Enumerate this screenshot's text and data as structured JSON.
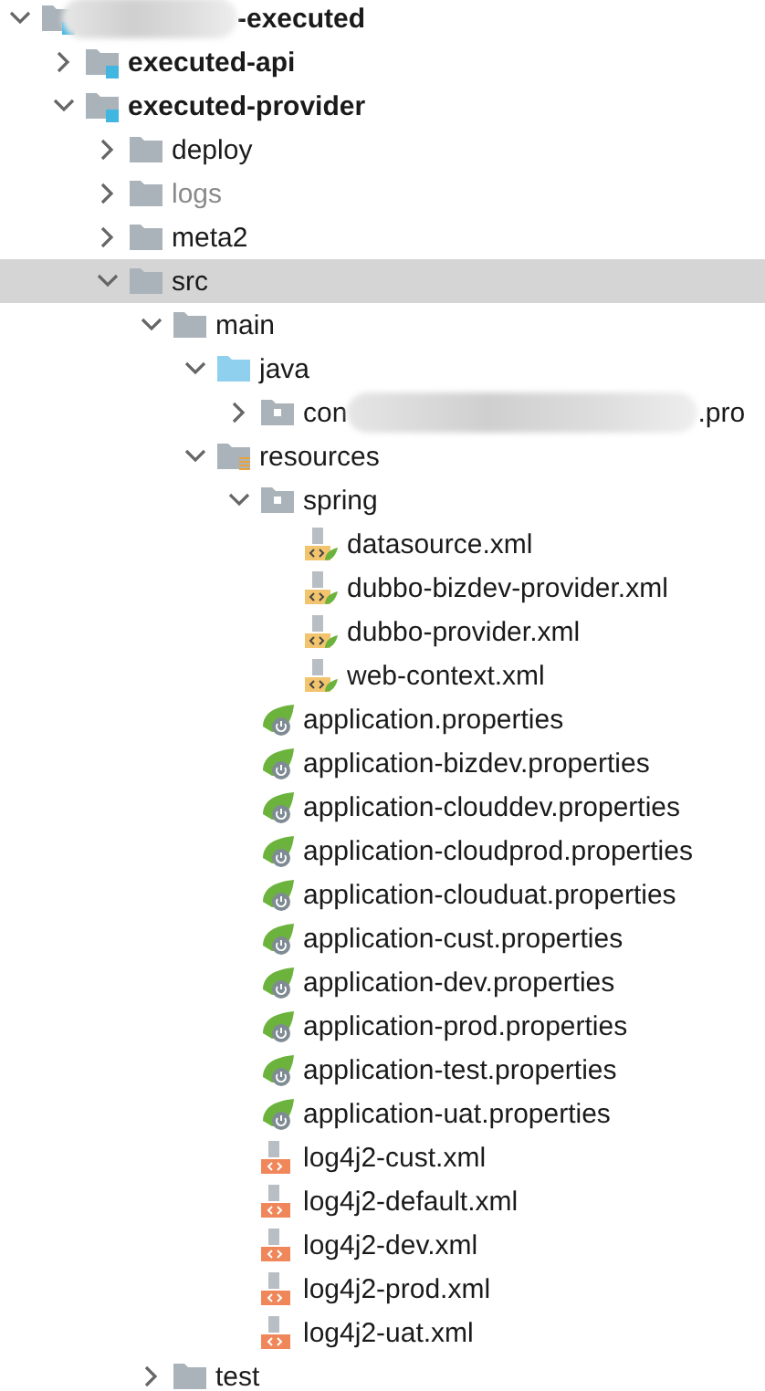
{
  "tree": [
    {
      "label": "-executed",
      "kind": "module",
      "redacted": true,
      "expanded": true,
      "selected": false,
      "children": [
        {
          "label": "executed-api",
          "kind": "module",
          "expanded": false,
          "selected": false
        },
        {
          "label": "executed-provider",
          "kind": "module",
          "expanded": true,
          "selected": false,
          "children": [
            {
              "label": "deploy",
              "kind": "folder",
              "expanded": false,
              "selected": false,
              "excluded": false
            },
            {
              "label": "logs",
              "kind": "folder",
              "expanded": false,
              "selected": false,
              "excluded": true
            },
            {
              "label": "meta2",
              "kind": "folder",
              "expanded": false,
              "selected": false,
              "excluded": false
            },
            {
              "label": "src",
              "kind": "folder",
              "expanded": true,
              "selected": true,
              "excluded": false,
              "children": [
                {
                  "label": "main",
                  "kind": "folder",
                  "expanded": true,
                  "selected": false,
                  "excluded": false,
                  "children": [
                    {
                      "label": "java",
                      "kind": "source-folder",
                      "expanded": true,
                      "selected": false,
                      "children": [
                        {
                          "label": "con",
                          "label_tail": ".pro",
                          "kind": "package",
                          "redacted": true,
                          "expanded": false,
                          "selected": false
                        }
                      ]
                    },
                    {
                      "label": "resources",
                      "kind": "resources-folder",
                      "expanded": true,
                      "selected": false,
                      "children": [
                        {
                          "label": "spring",
                          "kind": "package",
                          "expanded": true,
                          "selected": false,
                          "children": [
                            {
                              "label": "datasource.xml",
                              "kind": "spring-xml",
                              "selected": false
                            },
                            {
                              "label": "dubbo-bizdev-provider.xml",
                              "kind": "spring-xml",
                              "selected": false
                            },
                            {
                              "label": "dubbo-provider.xml",
                              "kind": "spring-xml",
                              "selected": false
                            },
                            {
                              "label": "web-context.xml",
                              "kind": "spring-xml",
                              "selected": false
                            }
                          ]
                        },
                        {
                          "label": "application.properties",
                          "kind": "properties",
                          "selected": false
                        },
                        {
                          "label": "application-bizdev.properties",
                          "kind": "properties",
                          "selected": false
                        },
                        {
                          "label": "application-clouddev.properties",
                          "kind": "properties",
                          "selected": false
                        },
                        {
                          "label": "application-cloudprod.properties",
                          "kind": "properties",
                          "selected": false
                        },
                        {
                          "label": "application-clouduat.properties",
                          "kind": "properties",
                          "selected": false
                        },
                        {
                          "label": "application-cust.properties",
                          "kind": "properties",
                          "selected": false
                        },
                        {
                          "label": "application-dev.properties",
                          "kind": "properties",
                          "selected": false
                        },
                        {
                          "label": "application-prod.properties",
                          "kind": "properties",
                          "selected": false
                        },
                        {
                          "label": "application-test.properties",
                          "kind": "properties",
                          "selected": false
                        },
                        {
                          "label": "application-uat.properties",
                          "kind": "properties",
                          "selected": false
                        },
                        {
                          "label": "log4j2-cust.xml",
                          "kind": "xml",
                          "selected": false
                        },
                        {
                          "label": "log4j2-default.xml",
                          "kind": "xml",
                          "selected": false
                        },
                        {
                          "label": "log4j2-dev.xml",
                          "kind": "xml",
                          "selected": false
                        },
                        {
                          "label": "log4j2-prod.xml",
                          "kind": "xml",
                          "selected": false
                        },
                        {
                          "label": "log4j2-uat.xml",
                          "kind": "xml",
                          "selected": false
                        }
                      ]
                    }
                  ]
                },
                {
                  "label": "test",
                  "kind": "folder",
                  "expanded": false,
                  "selected": false,
                  "excluded": false
                }
              ]
            }
          ]
        }
      ]
    }
  ]
}
